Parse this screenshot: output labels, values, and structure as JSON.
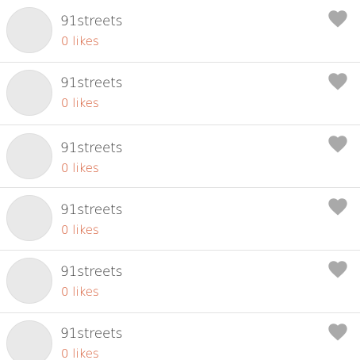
{
  "colors": {
    "likes_text": "#d4532c",
    "heart": "#a9a9a9",
    "avatar": "#e9e9e9",
    "divider": "#e2e2e2"
  },
  "list": {
    "items": [
      {
        "username": "91streets",
        "likes": "0 likes",
        "icon": "heart-icon"
      },
      {
        "username": "91streets",
        "likes": "0 likes",
        "icon": "heart-icon"
      },
      {
        "username": "91streets",
        "likes": "0 likes",
        "icon": "heart-icon"
      },
      {
        "username": "91streets",
        "likes": "0 likes",
        "icon": "heart-icon"
      },
      {
        "username": "91streets",
        "likes": "0 likes",
        "icon": "heart-icon"
      },
      {
        "username": "91streets",
        "likes": "0 likes",
        "icon": "heart-icon"
      }
    ]
  }
}
